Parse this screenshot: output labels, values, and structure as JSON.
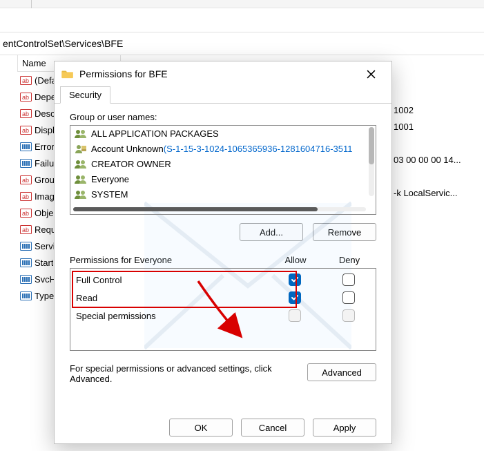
{
  "regedit": {
    "path": "entControlSet\\Services\\BFE",
    "name_header": "Name",
    "entries": [
      {
        "label": "(Defau",
        "type": "sz"
      },
      {
        "label": "Depen",
        "type": "multi"
      },
      {
        "label": "Descri",
        "type": "sz"
      },
      {
        "label": "Display",
        "type": "sz"
      },
      {
        "label": "ErrorC",
        "type": "dw"
      },
      {
        "label": "Failure",
        "type": "bin"
      },
      {
        "label": "Group",
        "type": "sz"
      },
      {
        "label": "Image",
        "type": "esz"
      },
      {
        "label": "Object",
        "type": "sz"
      },
      {
        "label": "Requir",
        "type": "multi"
      },
      {
        "label": "Servic",
        "type": "dw"
      },
      {
        "label": "Start",
        "type": "dw"
      },
      {
        "label": "SvcHos",
        "type": "dw"
      },
      {
        "label": "Type",
        "type": "dw"
      }
    ],
    "data_peek": {
      "r4": "1002",
      "r5": "1001",
      "r7": "03 00 00 00 14...",
      "r9": " -k LocalServic..."
    }
  },
  "dialog": {
    "title": "Permissions for BFE",
    "tab": "Security",
    "group_label": "Group or user names:",
    "principals": [
      {
        "name": "ALL APPLICATION PACKAGES",
        "kind": "group"
      },
      {
        "name_prefix": "Account Unknown",
        "sid": "(S-1-15-3-1024-1065365936-1281604716-3511",
        "kind": "unknown"
      },
      {
        "name": "CREATOR OWNER",
        "kind": "group"
      },
      {
        "name": "Everyone",
        "kind": "group"
      },
      {
        "name": "SYSTEM",
        "kind": "group"
      }
    ],
    "add_label": "Add...",
    "remove_label": "Remove",
    "perm_for_label": "Permissions for Everyone",
    "col_allow": "Allow",
    "col_deny": "Deny",
    "perm_rows": [
      {
        "name": "Full Control",
        "allow": true,
        "deny": false
      },
      {
        "name": "Read",
        "allow": true,
        "deny": false
      },
      {
        "name": "Special permissions",
        "allow": false,
        "deny": false,
        "disabled": true
      }
    ],
    "special_note": "For special permissions or advanced settings, click Advanced.",
    "advanced_label": "Advanced",
    "ok_label": "OK",
    "cancel_label": "Cancel",
    "apply_label": "Apply"
  }
}
